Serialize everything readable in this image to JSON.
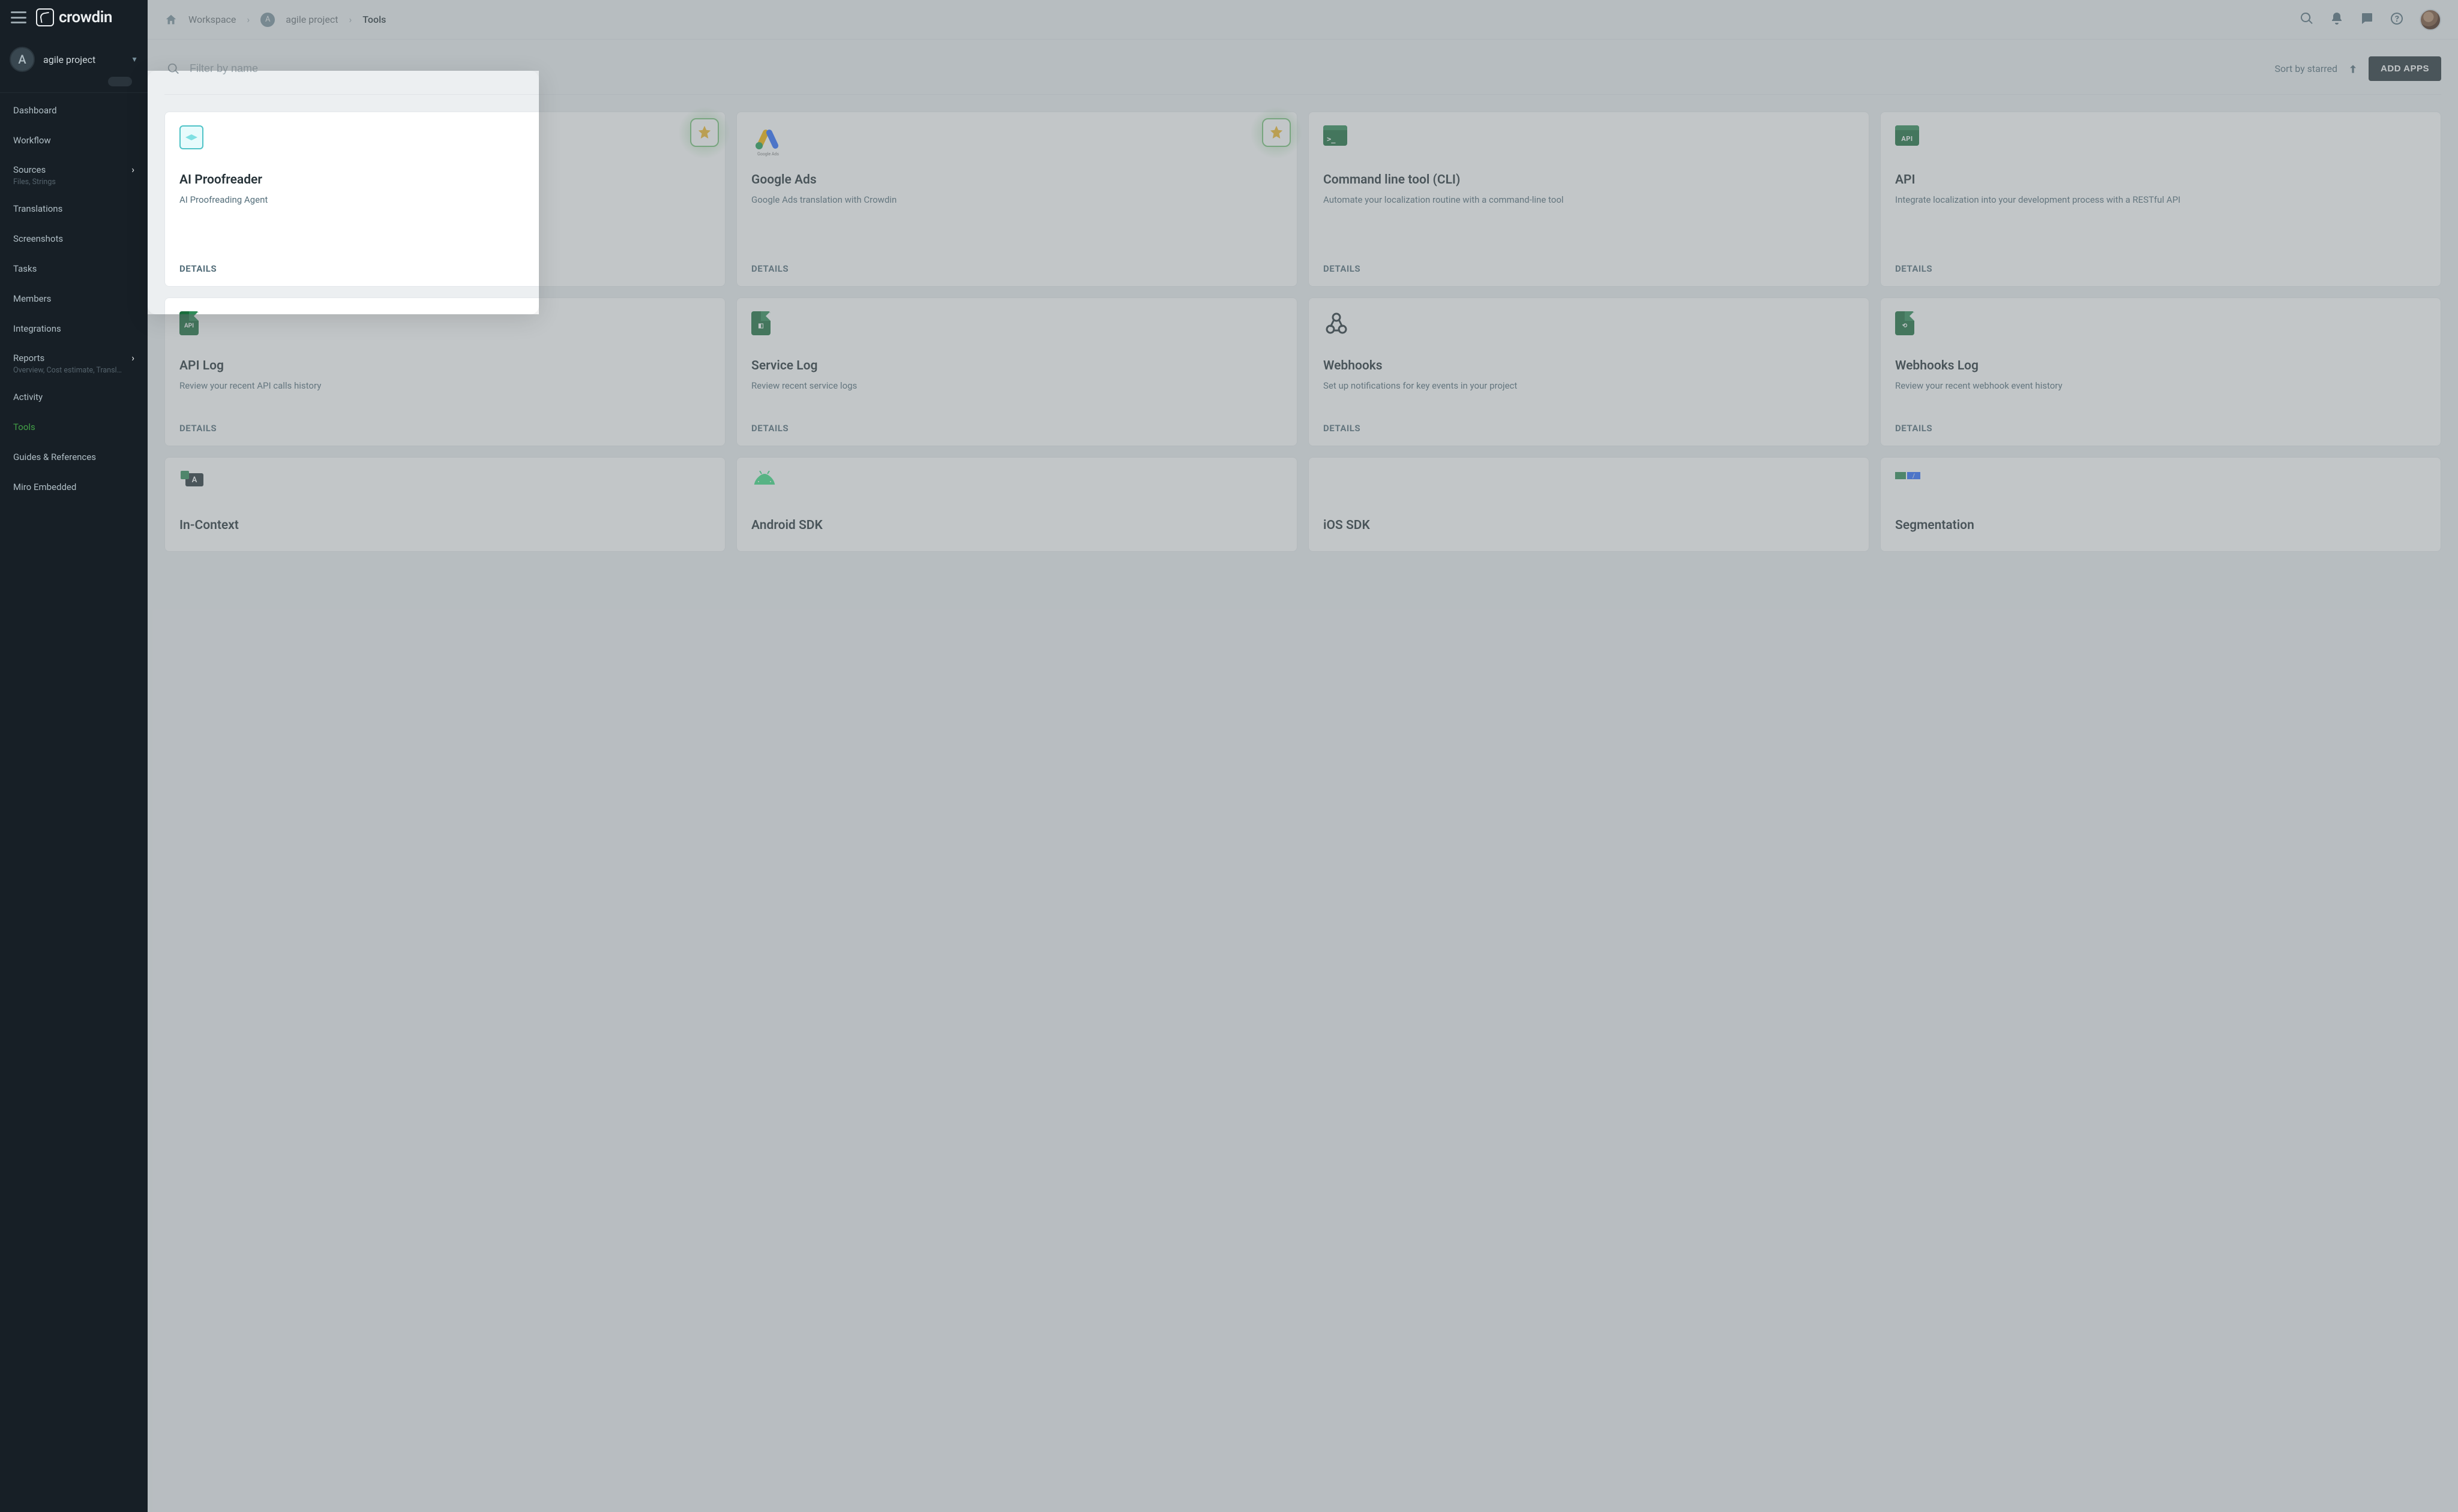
{
  "brand": "crowdin",
  "project": {
    "badge": "A",
    "name": "agile project"
  },
  "sidebar": {
    "items": [
      {
        "label": "Dashboard"
      },
      {
        "label": "Workflow"
      },
      {
        "label": "Sources",
        "sub": "Files, Strings",
        "chevron": true
      },
      {
        "label": "Translations"
      },
      {
        "label": "Screenshots"
      },
      {
        "label": "Tasks"
      },
      {
        "label": "Members"
      },
      {
        "label": "Integrations"
      },
      {
        "label": "Reports",
        "sub": "Overview, Cost estimate, Transl…",
        "chevron": true
      },
      {
        "label": "Activity"
      },
      {
        "label": "Tools",
        "active": true
      },
      {
        "label": "Guides & References"
      },
      {
        "label": "Miro Embedded"
      }
    ]
  },
  "breadcrumbs": {
    "workspace": "Workspace",
    "project_badge": "A",
    "project": "agile project",
    "current": "Tools"
  },
  "toolbar": {
    "search_placeholder": "Filter by name",
    "sort_label": "Sort by starred",
    "add_apps": "ADD APPS"
  },
  "details_label": "DETAILS",
  "cards": [
    {
      "title": "AI Proofreader",
      "desc": "AI Proofreading Agent",
      "starred": true,
      "icon": "diamond"
    },
    {
      "title": "Google Ads",
      "desc": "Google Ads translation with Crowdin",
      "starred": true,
      "icon": "google-ads"
    },
    {
      "title": "Command line tool (CLI)",
      "desc": "Automate your localization routine with a command-line tool",
      "icon": "terminal"
    },
    {
      "title": "API",
      "desc": "Integrate localization into your development process with a RESTful API",
      "icon": "api-win"
    },
    {
      "title": "API Log",
      "desc": "Review your recent API calls history",
      "icon": "doc-api"
    },
    {
      "title": "Service Log",
      "desc": "Review recent service logs",
      "icon": "doc-svc"
    },
    {
      "title": "Webhooks",
      "desc": "Set up notifications for key events in your project",
      "icon": "webhook"
    },
    {
      "title": "Webhooks Log",
      "desc": "Review your recent webhook event history",
      "icon": "doc-hook"
    },
    {
      "title": "In-Context",
      "desc": "",
      "icon": "incontext"
    },
    {
      "title": "Android SDK",
      "desc": "",
      "icon": "android"
    },
    {
      "title": "iOS SDK",
      "desc": "",
      "icon": "apple"
    },
    {
      "title": "Segmentation",
      "desc": "",
      "icon": "segmentation"
    }
  ]
}
